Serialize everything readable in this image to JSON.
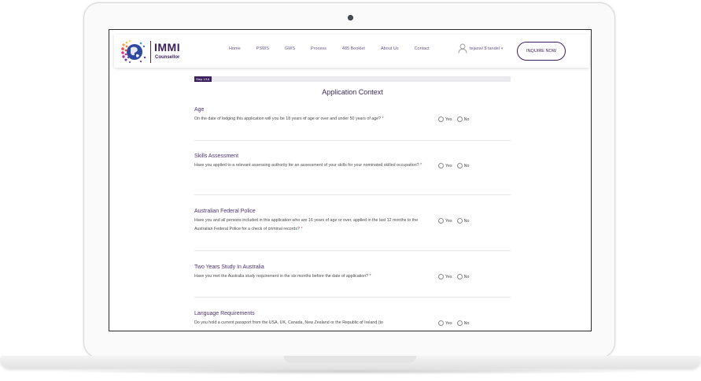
{
  "brand": {
    "title": "IMMI",
    "subtitle": "Counsellor"
  },
  "nav": {
    "items": [
      "Home",
      "PSWS",
      "GWS",
      "Process",
      "485 Booklet",
      "About Us",
      "Contact"
    ]
  },
  "user": {
    "name": "tejaswi $ tandel"
  },
  "inquire_button": "INQUIRE NOW",
  "progress": {
    "label": "Step 1/18",
    "value": 0.055
  },
  "page_title": "Application Context",
  "sections": [
    {
      "title": "Age",
      "question": "On the date of lodging this application will you be 18 years of age or over and under 50 years of age?",
      "required": "*",
      "options": [
        "Yes",
        "No"
      ]
    },
    {
      "title": "Skills Assessment",
      "question": "Have you applied to a relevant assessing authority for an assessment of your skills for your nominated skilled occupation?",
      "required": "*",
      "options": [
        "Yes",
        "No"
      ]
    },
    {
      "title": "Australian Federal Police",
      "question": "Have you and all persons included in this application who are 16 years of age or over, applied in the last 12 months to the Australian Federal Police for a check of criminal records?",
      "required": "*",
      "options": [
        "Yes",
        "No"
      ]
    },
    {
      "title": "Two Years Study In Australia",
      "question": "Have you met the Australia study requirement in the six months before the date of application?",
      "required": "*",
      "options": [
        "Yes",
        "No"
      ]
    },
    {
      "title": "Language Requirements",
      "question": "Do you hold a current passport from the USA, UK, Canada, New Zealand or the Republic of Ireland (to",
      "required": "",
      "options": [
        "Yes",
        "No"
      ]
    }
  ],
  "colors": {
    "brand_purple": "#3b1f5e",
    "required_red": "#d63a3a"
  }
}
